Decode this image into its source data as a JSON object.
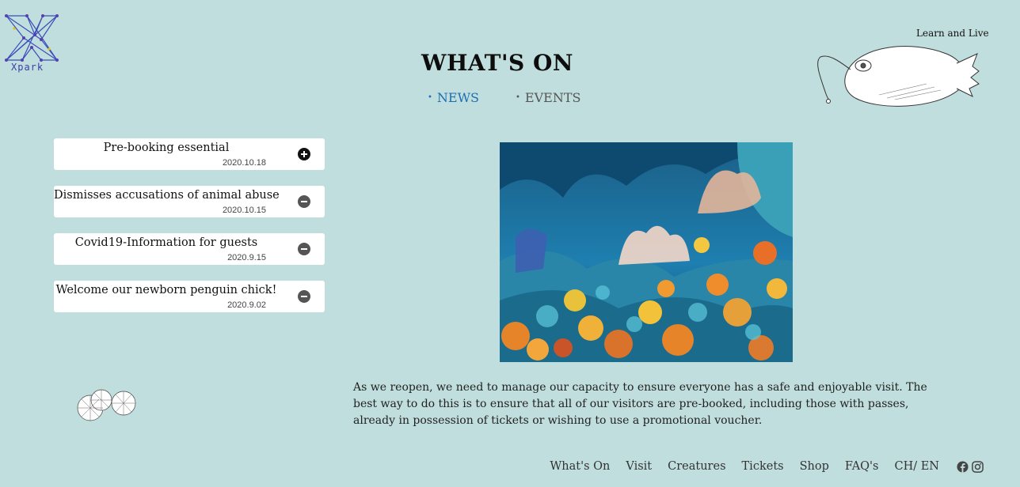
{
  "brand": {
    "logo_text": "Xpark",
    "tagline": "Learn and Live"
  },
  "header": {
    "title": "WHAT'S ON",
    "tabs": [
      {
        "label": "NEWS",
        "active": true
      },
      {
        "label": "EVENTS",
        "active": false
      }
    ]
  },
  "news": [
    {
      "title": "Pre-booking essential",
      "date": "2020.10.18",
      "state": "collapsed"
    },
    {
      "title": "Dismisses accusations of animal abuse",
      "date": "2020.10.15",
      "state": "expanded"
    },
    {
      "title": "Covid19-Information for guests",
      "date": "2020.9.15",
      "state": "expanded"
    },
    {
      "title": "Welcome our newborn penguin chick!",
      "date": "2020.9.02",
      "state": "expanded"
    }
  ],
  "article": {
    "body": "As we reopen, we need to manage our capacity to ensure everyone has a safe and enjoyable visit. The best way to do this is to ensure that all of our visitors are pre-booked, including those with passes, already in possession of tickets or wishing to use a promotional voucher."
  },
  "footer": {
    "links": [
      "What's On",
      "Visit",
      "Creatures",
      "Tickets",
      "Shop",
      "FAQ's",
      "CH/ EN"
    ],
    "social": [
      "facebook-icon",
      "instagram-icon"
    ]
  },
  "colors": {
    "background": "#c0dedd",
    "accent": "#1e6fb0"
  }
}
